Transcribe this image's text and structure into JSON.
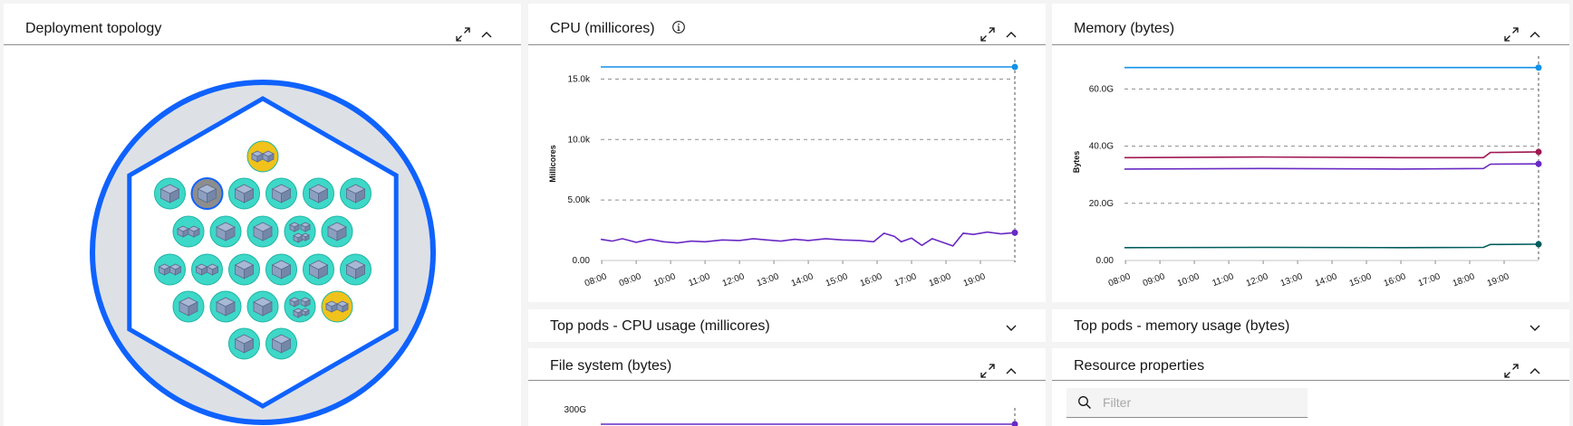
{
  "panels": {
    "topology": {
      "title": "Deployment topology"
    },
    "cpu": {
      "title": "CPU (millicores)"
    },
    "memory": {
      "title": "Memory (bytes)"
    },
    "top_cpu": {
      "title": "Top pods - CPU usage (millicores)"
    },
    "top_mem": {
      "title": "Top pods - memory usage (bytes)"
    },
    "filesystem": {
      "title": "File system (bytes)"
    },
    "resource": {
      "title": "Resource properties",
      "filter_placeholder": "Filter"
    }
  },
  "icons": {
    "expand": "expand-icon",
    "collapse": "chevron-up-icon",
    "chevron_down": "chevron-down-icon",
    "info": "info-icon",
    "search": "search-icon"
  },
  "colors": {
    "blue": "#1192e8",
    "purple": "#6929c4",
    "magenta": "#9f1853",
    "teal": "#005d5d",
    "pod_teal": "#3ed8c8",
    "pod_gold": "#f1c21b",
    "pod_gray": "#8d8d8d",
    "ring_blue": "#0f62fe"
  },
  "topology": {
    "rows": [
      [
        "gold-multi"
      ],
      [
        "single",
        "gray-single",
        "single",
        "single",
        "single",
        "single"
      ],
      [
        "multi",
        "single",
        "single",
        "quad",
        "single"
      ],
      [
        "multi",
        "multi",
        "single",
        "single",
        "single",
        "single"
      ],
      [
        "single",
        "single",
        "single",
        "quad",
        "gold-multi"
      ],
      [
        "single",
        "single"
      ]
    ]
  },
  "chart_data": [
    {
      "type": "line",
      "title": "CPU (millicores)",
      "ylabel": "Millicores",
      "xlabel": "",
      "ylim": [
        0,
        16000
      ],
      "x_ticks": [
        "08:00",
        "09:00",
        "10:00",
        "11:00",
        "12:00",
        "13:00",
        "14:00",
        "15:00",
        "16:00",
        "17:00",
        "18:00",
        "19:00"
      ],
      "y_ticks": [
        {
          "v": 0,
          "label": "0.00"
        },
        {
          "v": 5000,
          "label": "5.00k"
        },
        {
          "v": 10000,
          "label": "10.0k"
        },
        {
          "v": 15000,
          "label": "15.0k"
        }
      ],
      "x_range": [
        7.97,
        20.0
      ],
      "grid": true,
      "series": [
        {
          "color": "#1192e8",
          "points": [
            [
              7.97,
              16000
            ],
            [
              20.0,
              16000
            ]
          ]
        },
        {
          "color": "#6929c4",
          "points": [
            [
              7.97,
              1750
            ],
            [
              8.3,
              1600
            ],
            [
              8.6,
              1800
            ],
            [
              9.0,
              1500
            ],
            [
              9.4,
              1750
            ],
            [
              9.8,
              1550
            ],
            [
              10.2,
              1450
            ],
            [
              10.6,
              1600
            ],
            [
              11.0,
              1550
            ],
            [
              11.5,
              1700
            ],
            [
              12.0,
              1650
            ],
            [
              12.4,
              1800
            ],
            [
              12.8,
              1700
            ],
            [
              13.2,
              1600
            ],
            [
              13.6,
              1750
            ],
            [
              14.0,
              1650
            ],
            [
              14.5,
              1800
            ],
            [
              15.0,
              1700
            ],
            [
              15.5,
              1650
            ],
            [
              15.9,
              1550
            ],
            [
              16.2,
              2250
            ],
            [
              16.5,
              2000
            ],
            [
              16.7,
              1550
            ],
            [
              17.0,
              1850
            ],
            [
              17.3,
              1250
            ],
            [
              17.6,
              1800
            ],
            [
              17.9,
              1500
            ],
            [
              18.2,
              1200
            ],
            [
              18.5,
              2250
            ],
            [
              18.8,
              2150
            ],
            [
              19.2,
              2350
            ],
            [
              19.6,
              2200
            ],
            [
              20.0,
              2300
            ]
          ]
        }
      ]
    },
    {
      "type": "line",
      "title": "Memory (bytes)",
      "ylabel": "Bytes",
      "xlabel": "",
      "ylim": [
        0,
        69000000000
      ],
      "x_ticks": [
        "08:00",
        "09:00",
        "10:00",
        "11:00",
        "12:00",
        "13:00",
        "14:00",
        "15:00",
        "16:00",
        "17:00",
        "18:00",
        "19:00"
      ],
      "y_ticks": [
        {
          "v": 0,
          "label": "0.00"
        },
        {
          "v": 20000000000,
          "label": "20.0G"
        },
        {
          "v": 40000000000,
          "label": "40.0G"
        },
        {
          "v": 60000000000,
          "label": "60.0G"
        }
      ],
      "x_range": [
        7.97,
        20.0
      ],
      "grid": true,
      "series": [
        {
          "color": "#1192e8",
          "points": [
            [
              7.97,
              67500000000
            ],
            [
              20.0,
              67500000000
            ]
          ]
        },
        {
          "color": "#9f1853",
          "points": [
            [
              7.97,
              36000000000
            ],
            [
              12.0,
              36200000000
            ],
            [
              16.0,
              36000000000
            ],
            [
              18.4,
              36000000000
            ],
            [
              18.6,
              37800000000
            ],
            [
              20.0,
              38000000000
            ]
          ]
        },
        {
          "color": "#6929c4",
          "points": [
            [
              7.97,
              32000000000
            ],
            [
              12.0,
              32200000000
            ],
            [
              16.0,
              32000000000
            ],
            [
              18.4,
              32200000000
            ],
            [
              18.6,
              33700000000
            ],
            [
              20.0,
              33800000000
            ]
          ]
        },
        {
          "color": "#005d5d",
          "points": [
            [
              7.97,
              4500000000
            ],
            [
              12.0,
              4600000000
            ],
            [
              16.0,
              4500000000
            ],
            [
              18.4,
              4600000000
            ],
            [
              18.6,
              5600000000
            ],
            [
              20.0,
              5700000000
            ]
          ]
        }
      ]
    },
    {
      "type": "line",
      "title": "File system (bytes)",
      "ylabel": "",
      "xlabel": "",
      "y_ticks": [
        {
          "v": 300,
          "label": "300G"
        }
      ],
      "series": [
        {
          "color": "#6929c4",
          "values": [
            288,
            288
          ]
        }
      ]
    }
  ]
}
